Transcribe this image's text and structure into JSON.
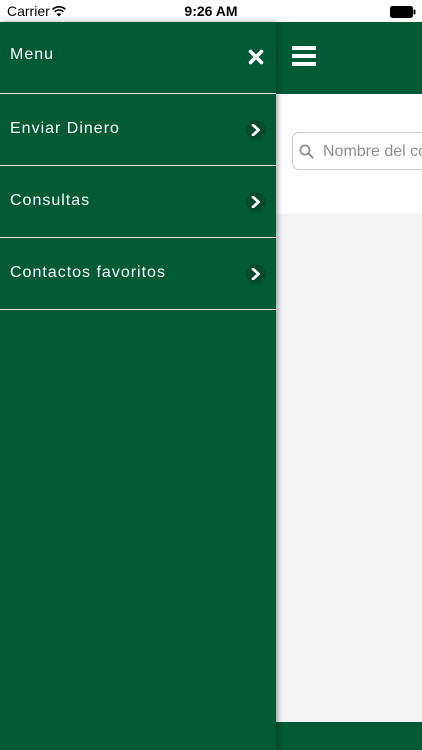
{
  "status_bar": {
    "carrier": "Carrier",
    "time": "9:26 AM"
  },
  "colors": {
    "brand_green": "#005a36",
    "divider": "#d7e4dc"
  },
  "drawer": {
    "title": "Menu",
    "close_icon": "close-icon",
    "items": [
      {
        "label": "Enviar Dinero",
        "icon": "chevron-right-icon"
      },
      {
        "label": "Consultas",
        "icon": "chevron-right-icon"
      },
      {
        "label": "Contactos favoritos",
        "icon": "chevron-right-icon"
      }
    ]
  },
  "main": {
    "menu_icon": "hamburger-icon",
    "search": {
      "placeholder": "Nombre del co"
    }
  }
}
